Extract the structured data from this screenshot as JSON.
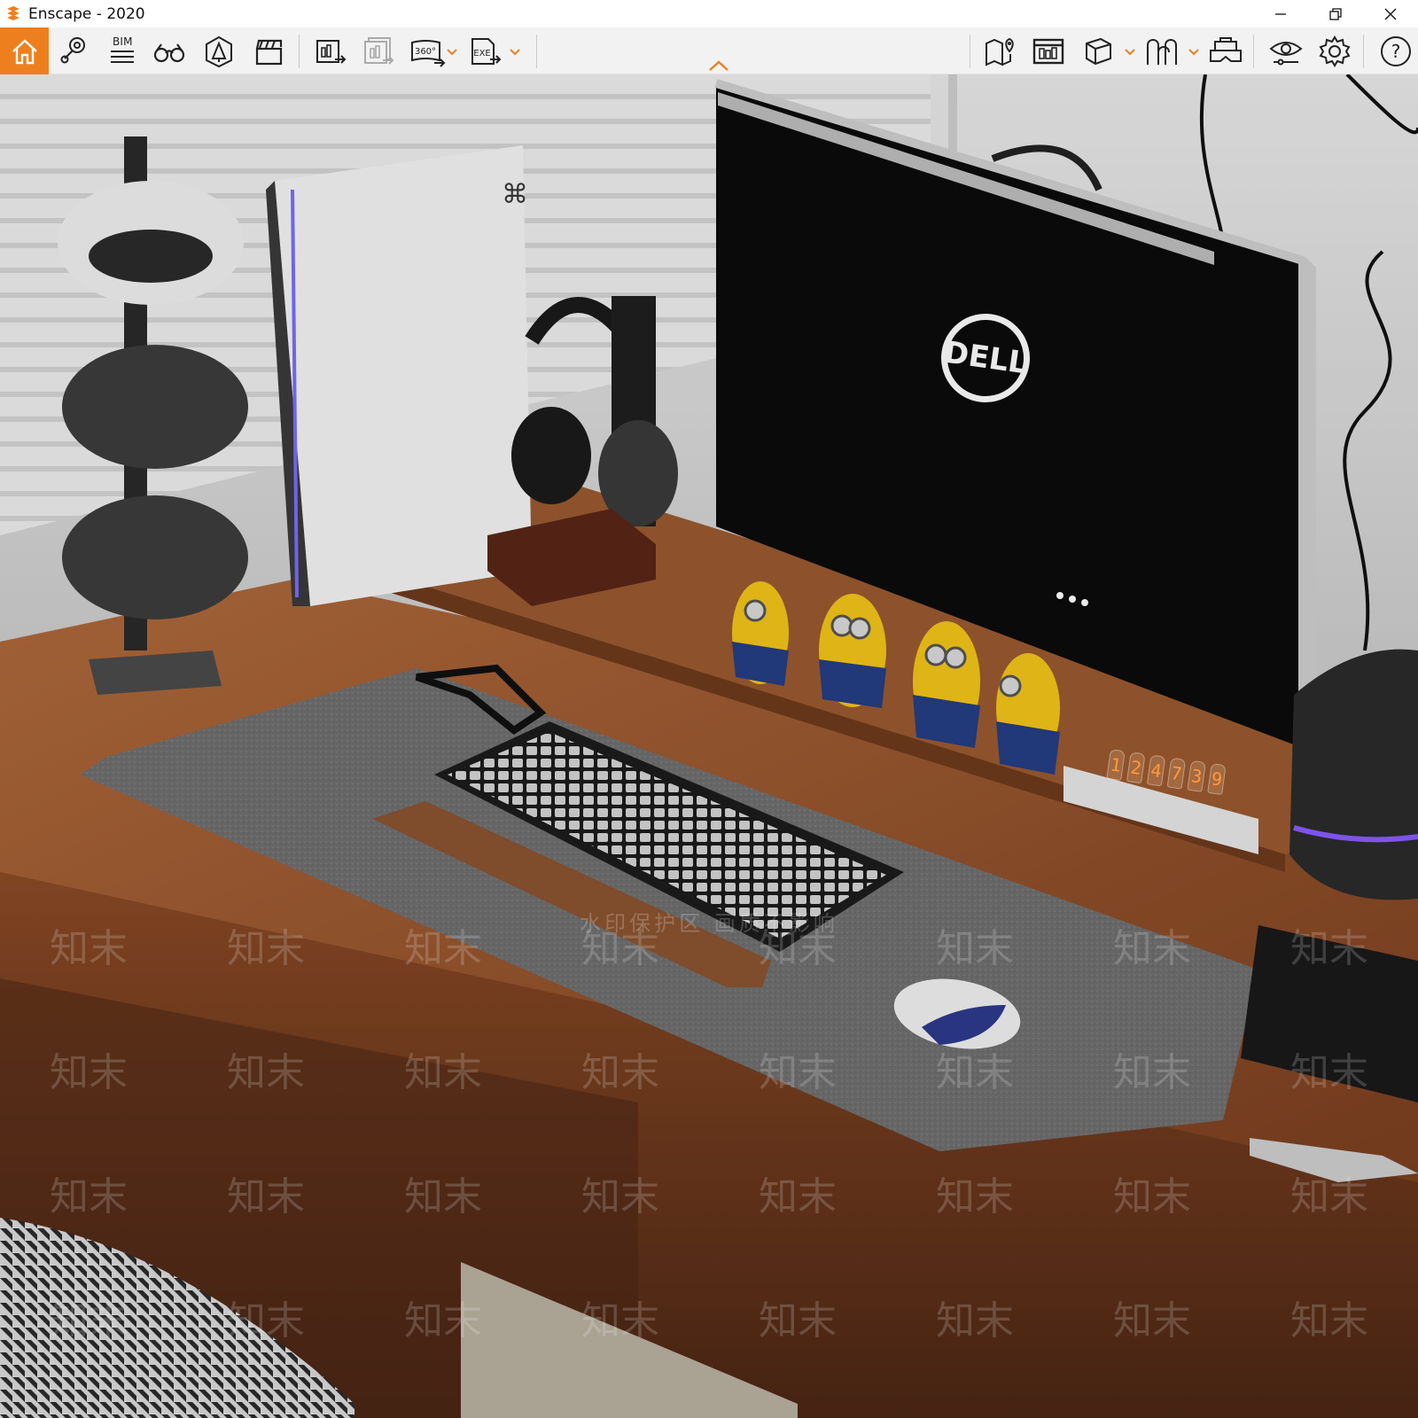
{
  "window": {
    "title": "Enscape - 2020",
    "controls": [
      "minimize",
      "restore",
      "close"
    ]
  },
  "toolbar": {
    "accent_color": "#ee7f1f",
    "left_group": [
      {
        "name": "home",
        "icon": "home-icon",
        "active": true
      },
      {
        "name": "navigation",
        "icon": "map-pin-icon"
      },
      {
        "name": "bim",
        "icon": "bim-list-icon",
        "label": "BIM"
      },
      {
        "name": "views",
        "icon": "binoculars-icon"
      },
      {
        "name": "atmosphere",
        "icon": "scene-lighting-icon"
      },
      {
        "name": "video-editor",
        "icon": "clapperboard-icon"
      },
      {
        "name": "screenshot",
        "icon": "render-export-icon"
      },
      {
        "name": "batch-rendering",
        "icon": "batch-render-icon",
        "disabled": true
      },
      {
        "name": "panorama",
        "icon": "panorama-360-icon",
        "label": "360°",
        "has_dropdown": true
      },
      {
        "name": "export-exe",
        "icon": "export-exe-icon",
        "label": "EXE",
        "has_dropdown": true
      }
    ],
    "right_group": [
      {
        "name": "map",
        "icon": "map-icon"
      },
      {
        "name": "asset-library",
        "icon": "asset-library-icon"
      },
      {
        "name": "material-editor",
        "icon": "cube-icon",
        "has_dropdown": true
      },
      {
        "name": "collaborative-annotations",
        "icon": "annotations-icon",
        "has_dropdown": true
      },
      {
        "name": "vr-headset",
        "icon": "vr-headset-icon"
      },
      {
        "name": "visual-settings",
        "icon": "eye-settings-icon"
      },
      {
        "name": "general-settings",
        "icon": "gear-icon"
      },
      {
        "name": "help",
        "icon": "help-icon",
        "label": "?"
      }
    ]
  },
  "viewport": {
    "description_visible_text": {
      "monitor_brand": "DELL",
      "nixie_digits": [
        "1",
        "2",
        "4",
        "7",
        "3",
        "9"
      ],
      "watermark": "知末",
      "watermark_banner": "水印保护区 画质不影响"
    }
  }
}
